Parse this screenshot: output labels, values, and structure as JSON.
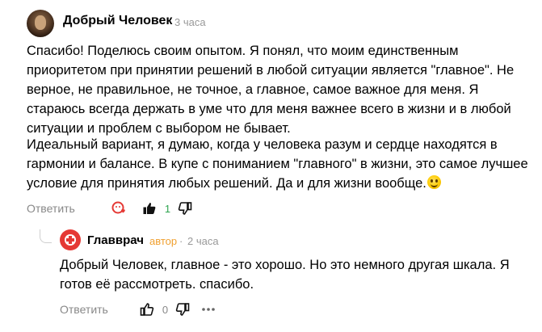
{
  "comment": {
    "author": "Добрый Человек",
    "time": "3 часа",
    "paragraphs": [
      "Спасибо! Поделюсь своим опытом. Я понял, что моим единственным приоритетом при принятии решений в любой ситуации является \"главное\". Не верное, не правильное, не точное, а главное, самое важное для меня. Я стараюсь всегда держать в уме что для меня важнее всего в жизни и в любой ситуации и проблем с выбором не бывает.",
      "Идеальный вариант, я думаю, когда у человека разум и сердце находятся в гармонии и балансе. В купе с пониманием \"главного\" в жизни, это самое лучшее условие для принятия любых решений. Да и для жизни вообще."
    ],
    "reply_label": "Ответить",
    "like_count": "1"
  },
  "reply": {
    "author": "Главврач",
    "badge": "автор",
    "separator": "·",
    "time": "2 часа",
    "text": "Добрый Человек, главное - это хорошо. Но это немного другая шкала. Я готов её рассмотреть. спасибо.",
    "reply_label": "Ответить",
    "like_count": "0"
  },
  "colors": {
    "like_green": "#2ea44f",
    "reaction_red": "#e53935",
    "author_badge": "#f0a030",
    "muted": "#888888"
  }
}
